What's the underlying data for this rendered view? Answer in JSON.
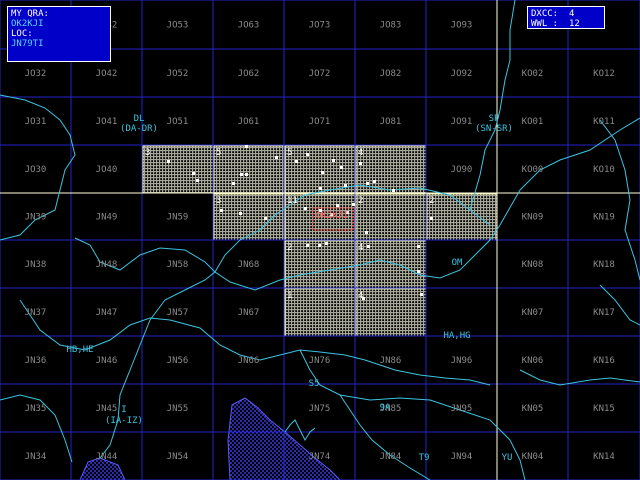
{
  "info_box": {
    "qra_label": "MY QRA:",
    "qra_value": "OK2KJI",
    "loc_label": "LOC:",
    "loc_value": "JN79TI"
  },
  "stats_box": {
    "dxcc_label": "DXCC:",
    "dxcc_value": "4",
    "wwl_label": "WWL :",
    "wwl_value": "12"
  },
  "locator_labels": [
    {
      "id": "JO22",
      "text": ""
    },
    {
      "id": "JO42",
      "text": "JO42"
    },
    {
      "id": "JO53",
      "text": "JO53"
    },
    {
      "id": "JO63",
      "text": "JO63"
    },
    {
      "id": "JO73",
      "text": "JO73"
    },
    {
      "id": "JO83",
      "text": "JO83"
    },
    {
      "id": "JO93",
      "text": "JO93"
    },
    {
      "id": "JO32",
      "text": "JO32"
    },
    {
      "id": "JO42b",
      "text": "JO42"
    },
    {
      "id": "JO52",
      "text": "JO52"
    },
    {
      "id": "JO62",
      "text": "JO62"
    },
    {
      "id": "JO72",
      "text": "JO72"
    },
    {
      "id": "JO82",
      "text": "JO82"
    },
    {
      "id": "JO92",
      "text": "JO92"
    },
    {
      "id": "KO02",
      "text": "KO02"
    },
    {
      "id": "KO12",
      "text": "KO12"
    },
    {
      "id": "JO31",
      "text": "JO31"
    },
    {
      "id": "JO41",
      "text": "JO41"
    },
    {
      "id": "JO51",
      "text": "JO51"
    },
    {
      "id": "JO61",
      "text": "JO61"
    },
    {
      "id": "JO71",
      "text": "JO71"
    },
    {
      "id": "JO81",
      "text": "JO81"
    },
    {
      "id": "JO91",
      "text": "JO91"
    },
    {
      "id": "KO01",
      "text": "KO01"
    },
    {
      "id": "KO11",
      "text": "KO11"
    },
    {
      "id": "JO30",
      "text": "JO30"
    },
    {
      "id": "JO40",
      "text": "JO40"
    },
    {
      "id": "JO90",
      "text": "JO90"
    },
    {
      "id": "KO00",
      "text": "KO00"
    },
    {
      "id": "KO10",
      "text": "KO10"
    },
    {
      "id": "JN39",
      "text": "JN39"
    },
    {
      "id": "JN49",
      "text": "JN49"
    },
    {
      "id": "JN59",
      "text": "JN59"
    },
    {
      "id": "KN09",
      "text": "KN09"
    },
    {
      "id": "KN19",
      "text": "KN19"
    },
    {
      "id": "JN38",
      "text": "JN38"
    },
    {
      "id": "JN48",
      "text": "JN48"
    },
    {
      "id": "JN58",
      "text": "JN58"
    },
    {
      "id": "JN68",
      "text": "JN68"
    },
    {
      "id": "KN08",
      "text": "KN08"
    },
    {
      "id": "KN18",
      "text": "KN18"
    },
    {
      "id": "JN37",
      "text": "JN37"
    },
    {
      "id": "JN47",
      "text": "JN47"
    },
    {
      "id": "JN57",
      "text": "JN57"
    },
    {
      "id": "JN67",
      "text": "JN67"
    },
    {
      "id": "KN07",
      "text": "KN07"
    },
    {
      "id": "KN17",
      "text": "KN17"
    },
    {
      "id": "JN36",
      "text": "JN36"
    },
    {
      "id": "JN46",
      "text": "JN46"
    },
    {
      "id": "JN56",
      "text": "JN56"
    },
    {
      "id": "JN66",
      "text": "JN66"
    },
    {
      "id": "JN76",
      "text": "JN76"
    },
    {
      "id": "JN86",
      "text": "JN86"
    },
    {
      "id": "JN96",
      "text": "JN96"
    },
    {
      "id": "KN06",
      "text": "KN06"
    },
    {
      "id": "KN16",
      "text": "KN16"
    },
    {
      "id": "JN35",
      "text": "JN35"
    },
    {
      "id": "JN45",
      "text": "JN45"
    },
    {
      "id": "JN55",
      "text": "JN55"
    },
    {
      "id": "JN75",
      "text": "JN75"
    },
    {
      "id": "JN85",
      "text": "JN85"
    },
    {
      "id": "JN95",
      "text": "JN95"
    },
    {
      "id": "KN05",
      "text": "KN05"
    },
    {
      "id": "KN15",
      "text": "KN15"
    },
    {
      "id": "JN34",
      "text": "JN34"
    },
    {
      "id": "JN44",
      "text": "JN44"
    },
    {
      "id": "JN54",
      "text": "JN54"
    },
    {
      "id": "JN74",
      "text": "JN74"
    },
    {
      "id": "JN84",
      "text": "JN84"
    },
    {
      "id": "JN94",
      "text": "JN94"
    },
    {
      "id": "KN04",
      "text": "KN04"
    },
    {
      "id": "KN14",
      "text": "KN14"
    }
  ],
  "worked_squares": [
    {
      "id": "JO50",
      "count": "3"
    },
    {
      "id": "JO60",
      "count": "5"
    },
    {
      "id": "JO70",
      "count": "5"
    },
    {
      "id": "JO80",
      "count": "4"
    },
    {
      "id": "JN69",
      "count": "3"
    },
    {
      "id": "JN79",
      "count": "11"
    },
    {
      "id": "JN89",
      "count": "2"
    },
    {
      "id": "JN99",
      "count": "2"
    },
    {
      "id": "JN78",
      "count": "2"
    },
    {
      "id": "JN88",
      "count": "4"
    },
    {
      "id": "JN77",
      "count": "1"
    },
    {
      "id": "JN87",
      "count": "4"
    }
  ],
  "prefix_labels": [
    {
      "text": "DL"
    },
    {
      "text": "(DA-DR)"
    },
    {
      "text": "SP"
    },
    {
      "text": "(SN-SR)"
    },
    {
      "text": "OM"
    },
    {
      "text": "HB,HE"
    },
    {
      "text": "HA,HG"
    },
    {
      "text": "S5"
    },
    {
      "text": "9A"
    },
    {
      "text": "I"
    },
    {
      "text": "(IA-IZ)"
    },
    {
      "text": "T9"
    },
    {
      "text": "YU"
    }
  ],
  "home_marker": {
    "text": "OK2KJI"
  },
  "colors": {
    "grid_major": "#2a2ad0",
    "grid_highlight": "#ffffc0",
    "borders": "#3cc4e0",
    "worked_fill": "#b0b0a0",
    "station_dots": "#ffffff",
    "home": "#ff3030",
    "panel": "#0000c8"
  }
}
